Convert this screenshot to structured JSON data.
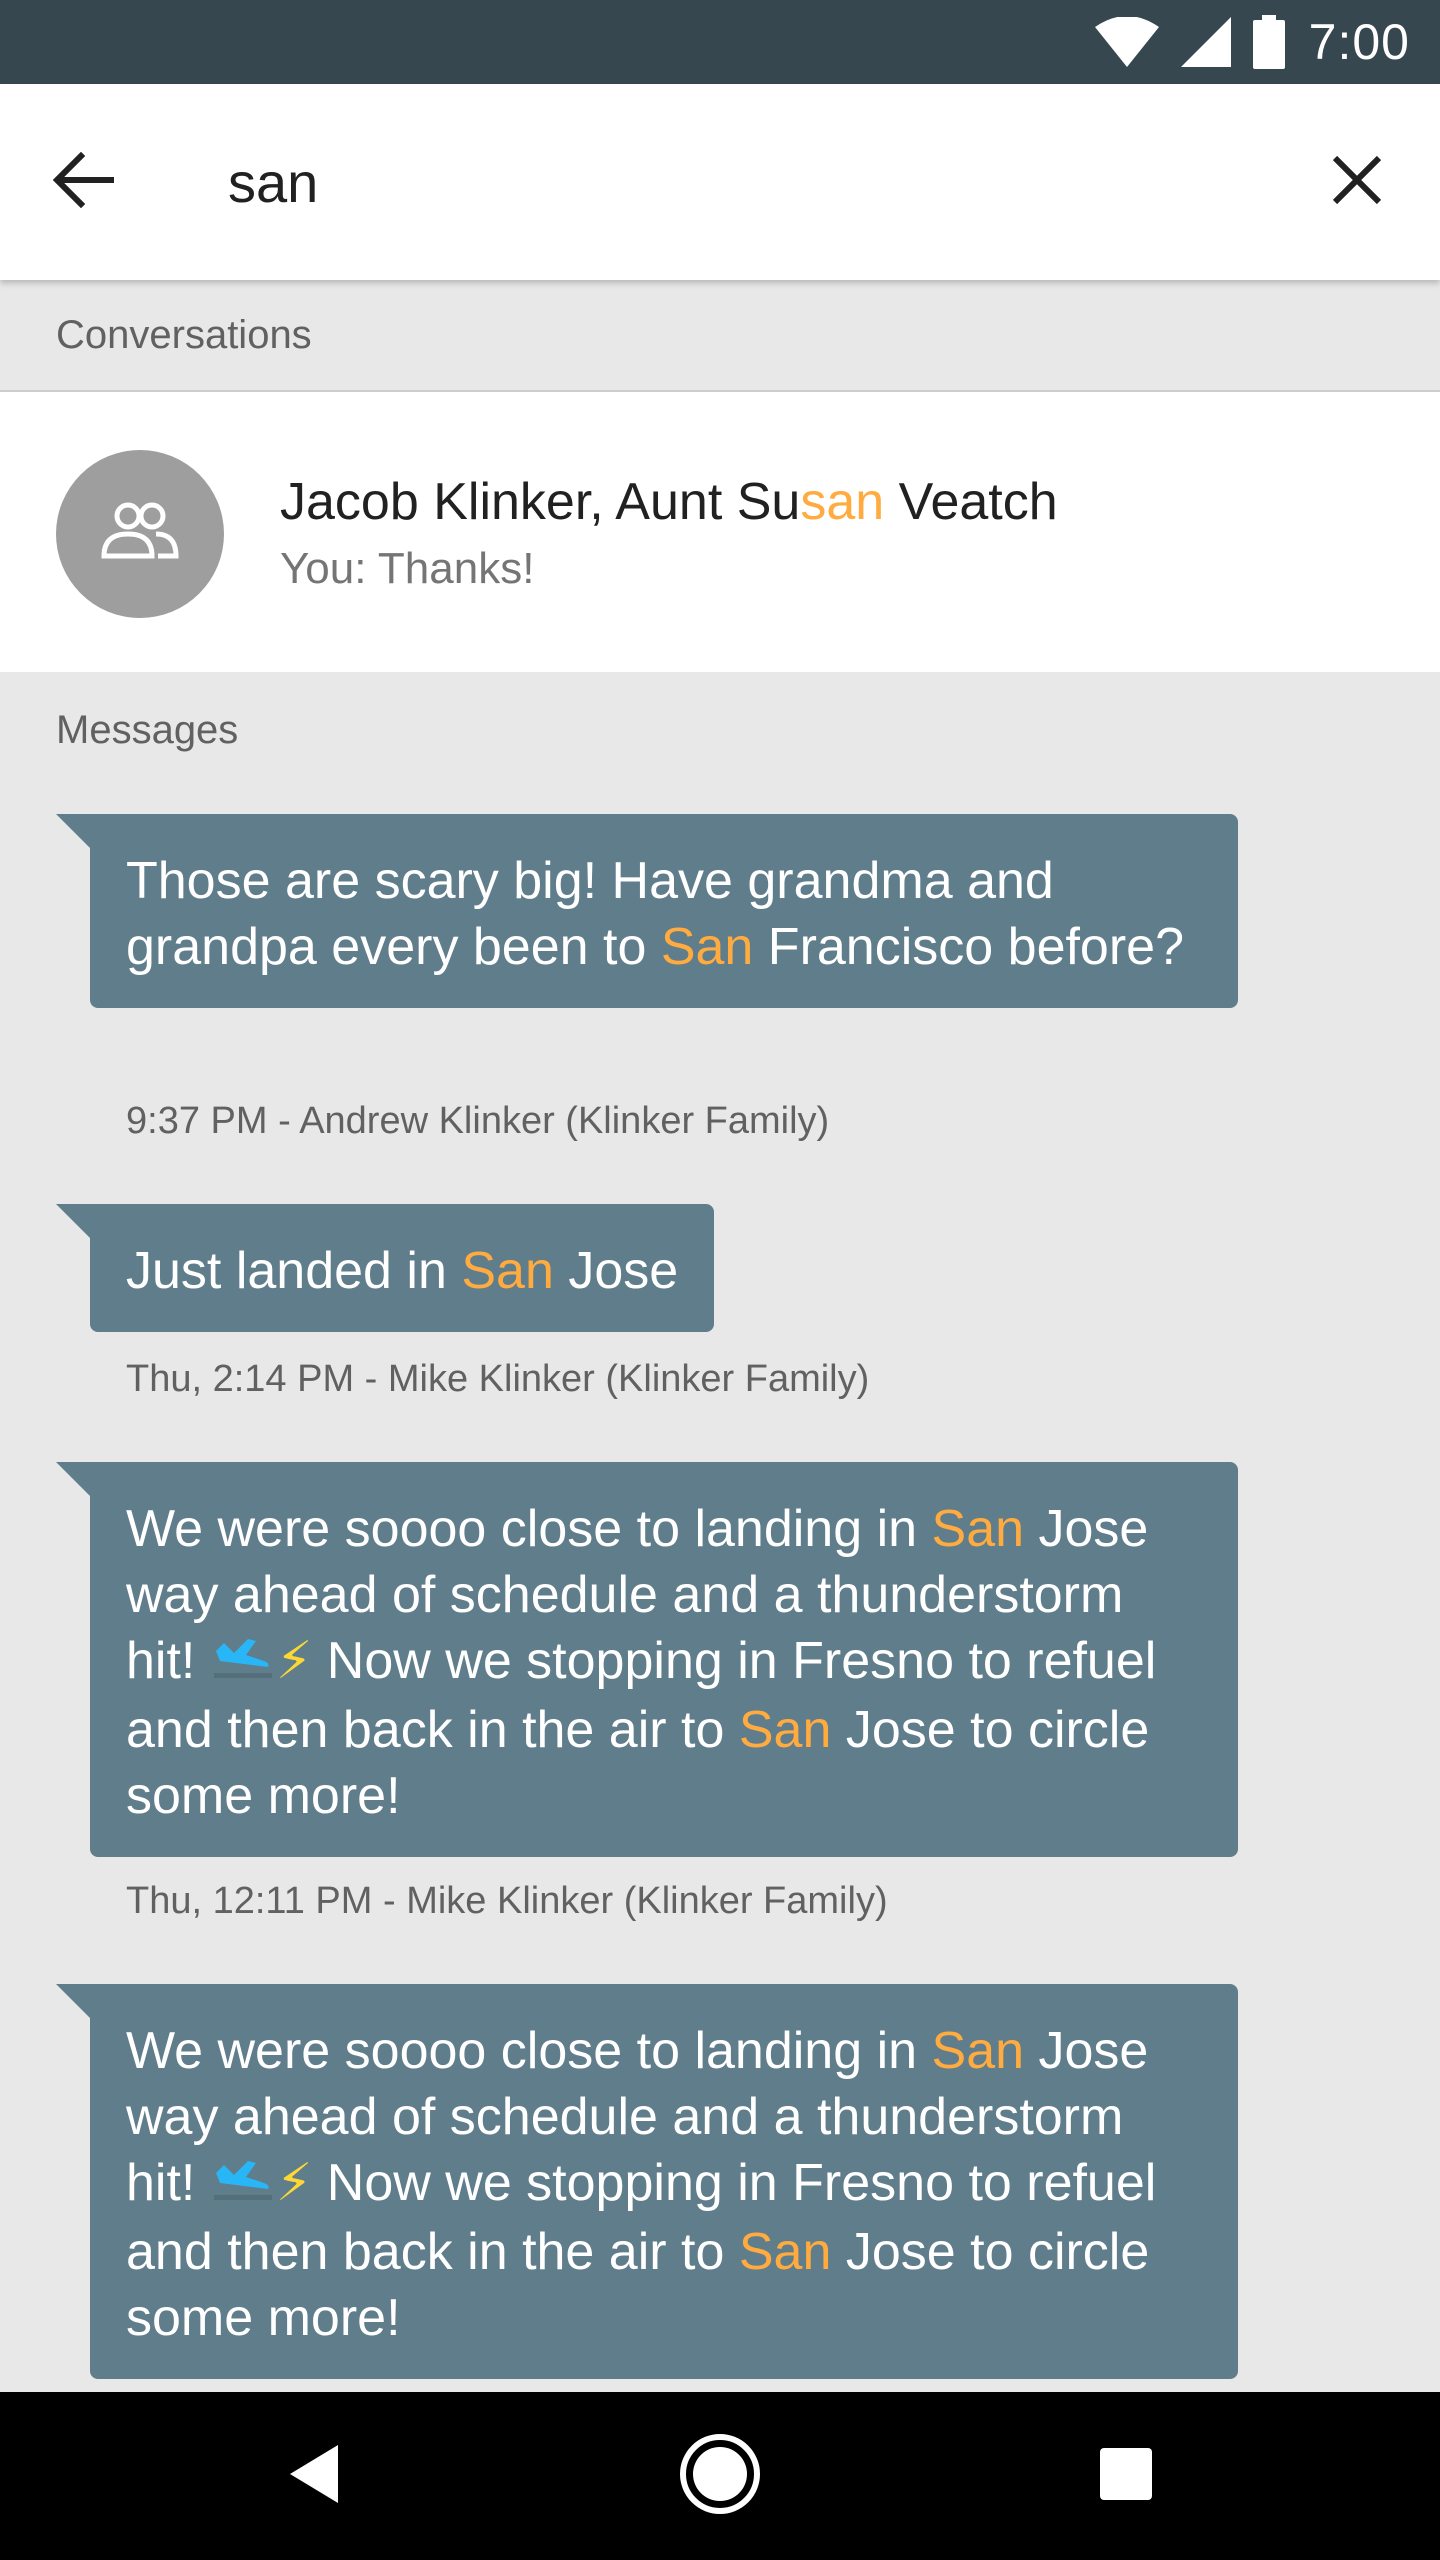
{
  "status_bar": {
    "time": "7:00",
    "icons": [
      "wifi-icon",
      "cellular-signal-icon",
      "battery-icon"
    ]
  },
  "search": {
    "query": "san",
    "back_icon": "arrow-back-icon",
    "clear_icon": "close-icon"
  },
  "sections": {
    "conversations": "Conversations",
    "messages": "Messages"
  },
  "conversation": {
    "avatar_icon": "group-icon",
    "title_before": "Jacob Klinker, Aunt Su",
    "title_highlight": "san",
    "title_after": " Veatch",
    "snippet": "You: Thanks!"
  },
  "messages": [
    {
      "segments": [
        {
          "text": "Those are scary big! Have grandma and grandpa every been to "
        },
        {
          "text": "San",
          "highlight": true
        },
        {
          "text": " Francisco before?"
        }
      ],
      "meta": "9:37 PM - Andrew Klinker (Klinker Family)"
    },
    {
      "segments": [
        {
          "text": "Just landed in "
        },
        {
          "text": "San",
          "highlight": true
        },
        {
          "text": " Jose"
        }
      ],
      "meta": "Thu, 2:14 PM - Mike Klinker (Klinker Family)"
    },
    {
      "segments": [
        {
          "text": "We were soooo close to landing in "
        },
        {
          "text": "San",
          "highlight": true
        },
        {
          "text": " Jose way ahead of schedule and a thunderstorm hit! "
        },
        {
          "emoji": "airplane-landing-icon"
        },
        {
          "text": "⚡"
        },
        {
          "text": " Now we stopping in Fresno to refuel and then back in the air to "
        },
        {
          "text": "San",
          "highlight": true
        },
        {
          "text": " Jose to circle some more!"
        }
      ],
      "meta": "Thu, 12:11 PM - Mike Klinker (Klinker Family)"
    },
    {
      "segments": [
        {
          "text": "We were soooo close to landing in "
        },
        {
          "text": "San",
          "highlight": true
        },
        {
          "text": " Jose way ahead of schedule and a thunderstorm hit! "
        },
        {
          "emoji": "airplane-landing-icon"
        },
        {
          "text": "⚡"
        },
        {
          "text": " Now we stopping in Fresno to refuel and then back in the air to "
        },
        {
          "text": "San",
          "highlight": true
        },
        {
          "text": " Jose to circle some more!"
        }
      ],
      "meta": ""
    }
  ],
  "colors": {
    "status_bar": "#37474f",
    "bubble": "#607d8b",
    "highlight": "#ffab40",
    "background": "#e8e8e8"
  },
  "nav_bar": {
    "icons": [
      "nav-back-icon",
      "nav-home-icon",
      "nav-recents-icon"
    ]
  }
}
